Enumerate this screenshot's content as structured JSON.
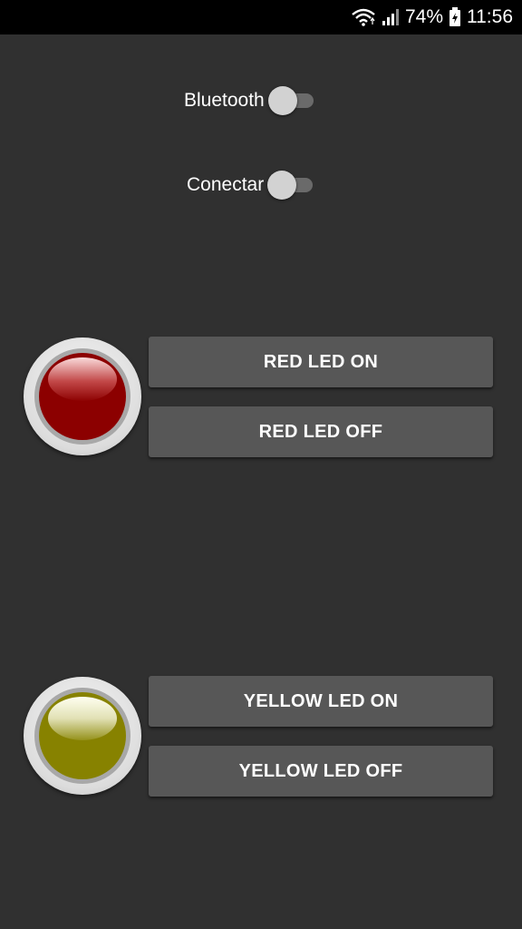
{
  "status_bar": {
    "battery_percent": "74%",
    "time": "11:56",
    "icons": [
      "wifi-icon",
      "signal-icon",
      "battery-charging-icon"
    ]
  },
  "switches": {
    "bluetooth": {
      "label": "Bluetooth",
      "on": false
    },
    "connect": {
      "label": "Conectar",
      "on": false
    }
  },
  "leds": {
    "red": {
      "color": "#8c0000",
      "on_label": "RED LED ON",
      "off_label": "RED LED OFF"
    },
    "yellow": {
      "color": "#878200",
      "on_label": "YELLOW LED ON",
      "off_label": "YELLOW LED OFF"
    }
  },
  "colors": {
    "background": "#303030",
    "button": "#575757",
    "status_bar": "#000000"
  }
}
